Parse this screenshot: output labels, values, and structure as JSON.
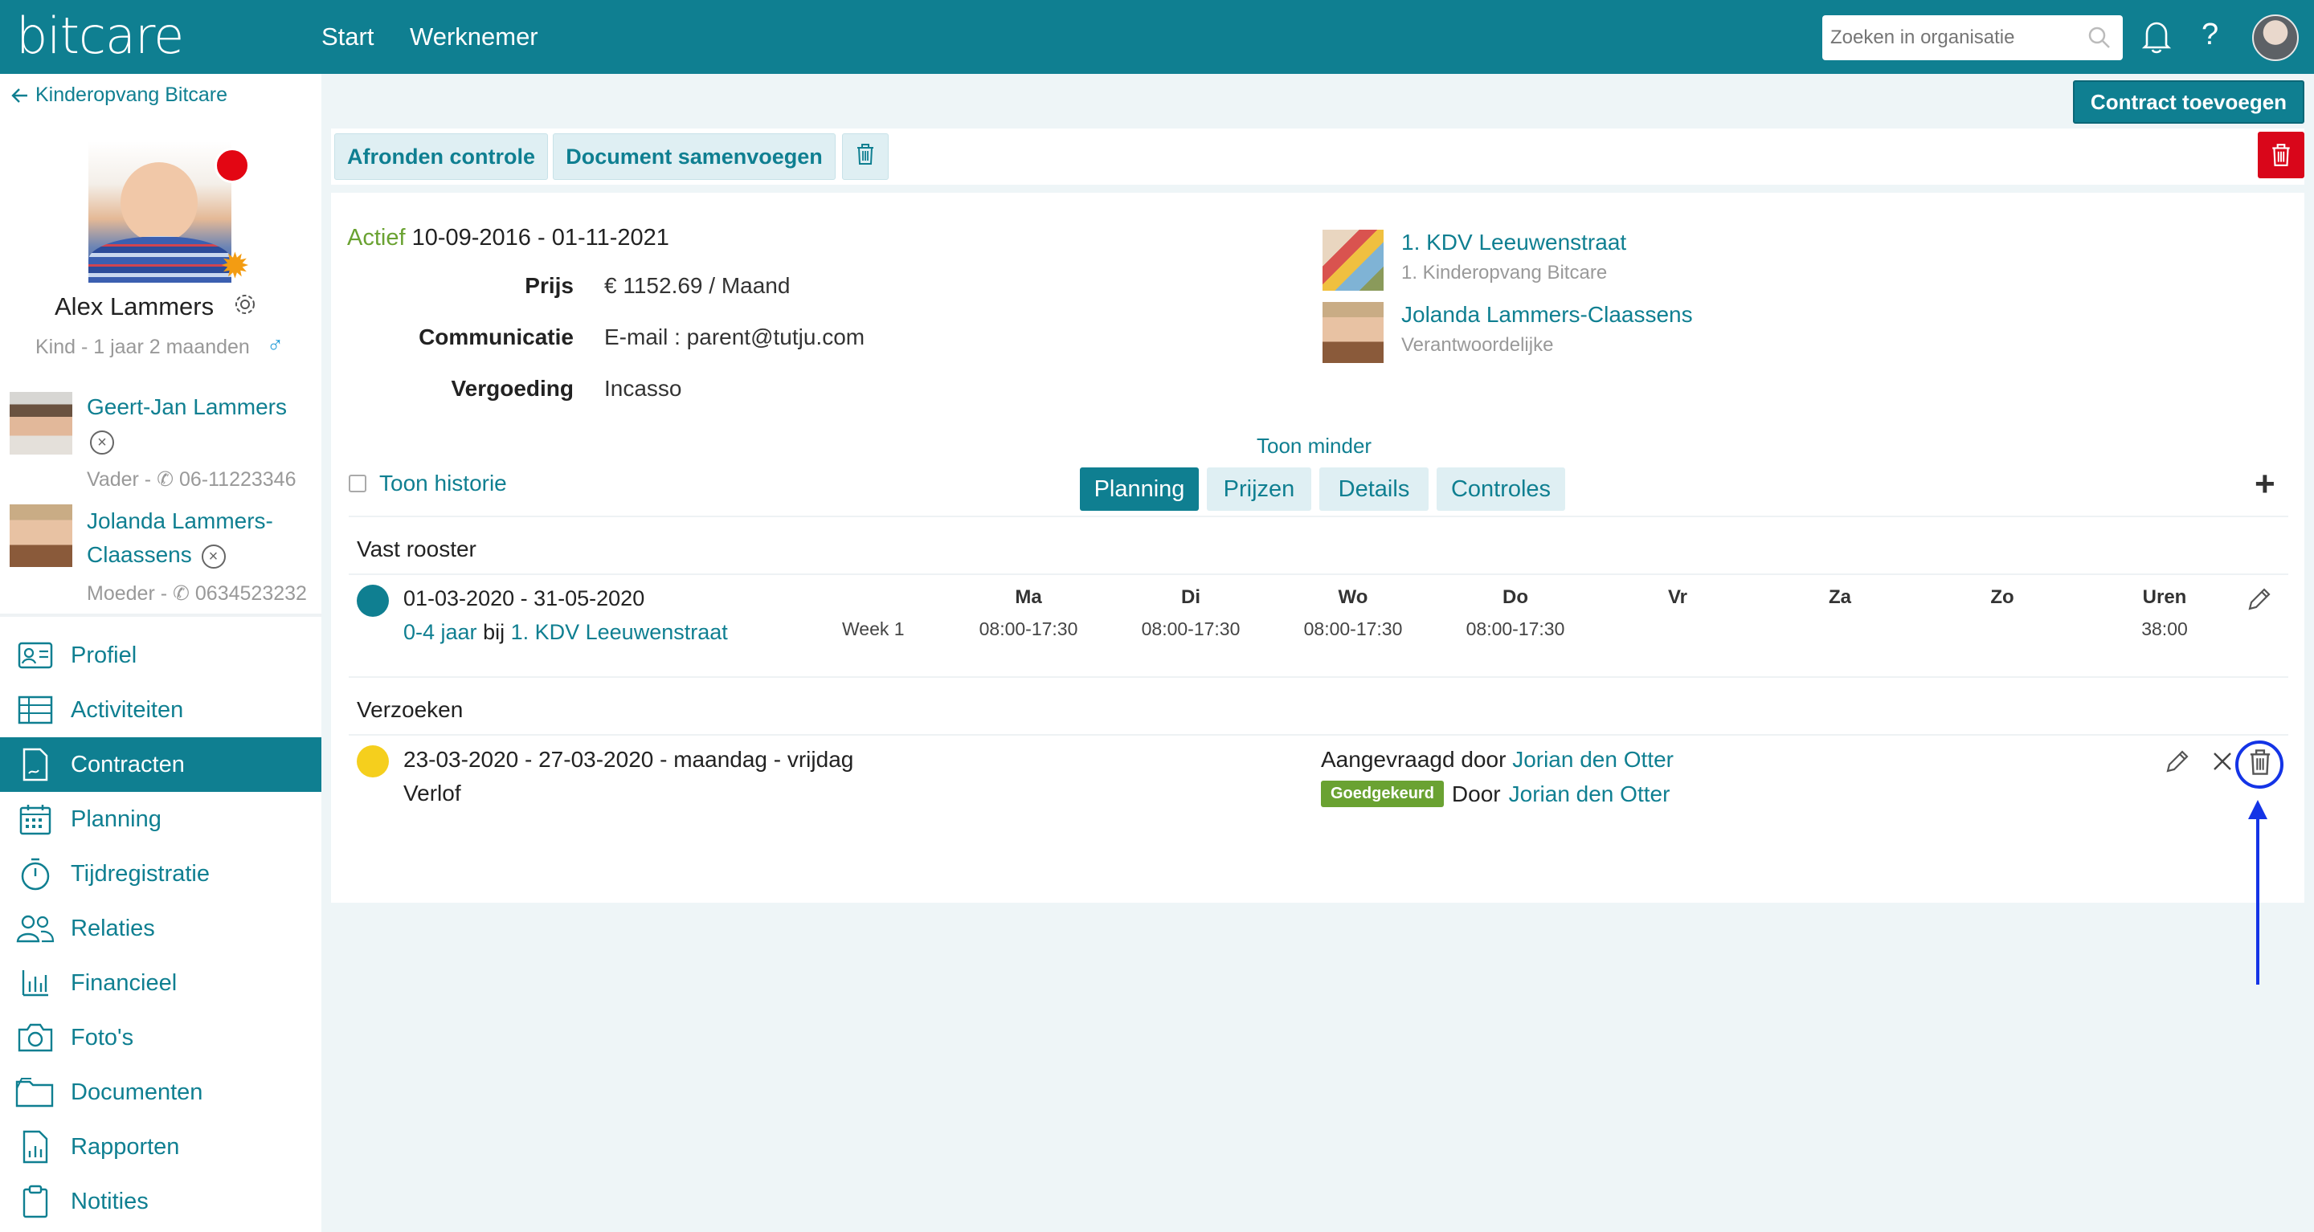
{
  "header": {
    "logo": "bitcare",
    "nav": [
      "Start",
      "Werknemer"
    ],
    "search_placeholder": "Zoeken in organisatie",
    "help": "?"
  },
  "sidebar": {
    "back_label": "Kinderopvang Bitcare",
    "child": {
      "name": "Alex Lammers",
      "subtitle": "Kind - 1 jaar 2 maanden",
      "gender_symbol": "♂"
    },
    "relations": [
      {
        "name": "Geert-Jan Lammers",
        "sub": "Vader - ",
        "phone": "06-11223346"
      },
      {
        "name_line1": "Jolanda Lammers-",
        "name_line2": "Claassens",
        "sub": "Moeder - ",
        "phone": "0634523232"
      }
    ],
    "nav": [
      {
        "label": "Profiel",
        "icon": "profile-card-icon"
      },
      {
        "label": "Activiteiten",
        "icon": "table-icon"
      },
      {
        "label": "Contracten",
        "icon": "contract-icon",
        "active": true
      },
      {
        "label": "Planning",
        "icon": "calendar-icon"
      },
      {
        "label": "Tijdregistratie",
        "icon": "stopwatch-icon"
      },
      {
        "label": "Relaties",
        "icon": "people-icon"
      },
      {
        "label": "Financieel",
        "icon": "bar-chart-icon"
      },
      {
        "label": "Foto's",
        "icon": "camera-icon"
      },
      {
        "label": "Documenten",
        "icon": "folder-icon"
      },
      {
        "label": "Rapporten",
        "icon": "report-icon"
      },
      {
        "label": "Notities",
        "icon": "clipboard-icon"
      }
    ]
  },
  "toolbar": {
    "add_contract": "Contract toevoegen",
    "finish_check": "Afronden controle",
    "merge_document": "Document samenvoegen"
  },
  "contract": {
    "status": "Actief",
    "period": "10-09-2016 - 01-11-2021",
    "price_label": "Prijs",
    "price_value": "€ 1152.69 / Maand",
    "communication_label": "Communicatie",
    "communication_value": "E-mail : parent@tutju.com",
    "compensation_label": "Vergoeding",
    "compensation_value": "Incasso",
    "location_name": "1. KDV Leeuwenstraat",
    "location_org": "1. Kinderopvang Bitcare",
    "responsible_name": "Jolanda Lammers-Claassens",
    "responsible_role": "Verantwoordelijke",
    "toggle_less": "Toon minder",
    "show_history": "Toon historie",
    "tabs": [
      "Planning",
      "Prijzen",
      "Details",
      "Controles"
    ],
    "active_tab": "Planning"
  },
  "schedule": {
    "title": "Vast rooster",
    "period": "01-03-2020 - 31-05-2020",
    "age_group": "0-4 jaar",
    "at": "bij",
    "location": "1. KDV Leeuwenstraat",
    "week": "Week 1",
    "days": [
      "Ma",
      "Di",
      "Wo",
      "Do",
      "Vr",
      "Za",
      "Zo"
    ],
    "times": [
      "08:00-17:30",
      "08:00-17:30",
      "08:00-17:30",
      "08:00-17:30",
      "",
      "",
      ""
    ],
    "hours_label": "Uren",
    "hours_value": "38:00",
    "dot_color": "#0f7f91"
  },
  "requests": {
    "title": "Verzoeken",
    "period": "23-03-2020 - 27-03-2020 - maandag - vrijdag",
    "type": "Verlof",
    "requested_by_label": "Aangevraagd door",
    "requested_by": "Jorian den Otter",
    "status_badge": "Goedgekeurd",
    "approved_by_label": "Door",
    "approved_by": "Jorian den Otter",
    "dot_color": "#f5cf1d"
  },
  "colors": {
    "brand": "#0f7f91",
    "danger": "#d9061a",
    "approved": "#6aa232",
    "annotation": "#1434e6"
  }
}
